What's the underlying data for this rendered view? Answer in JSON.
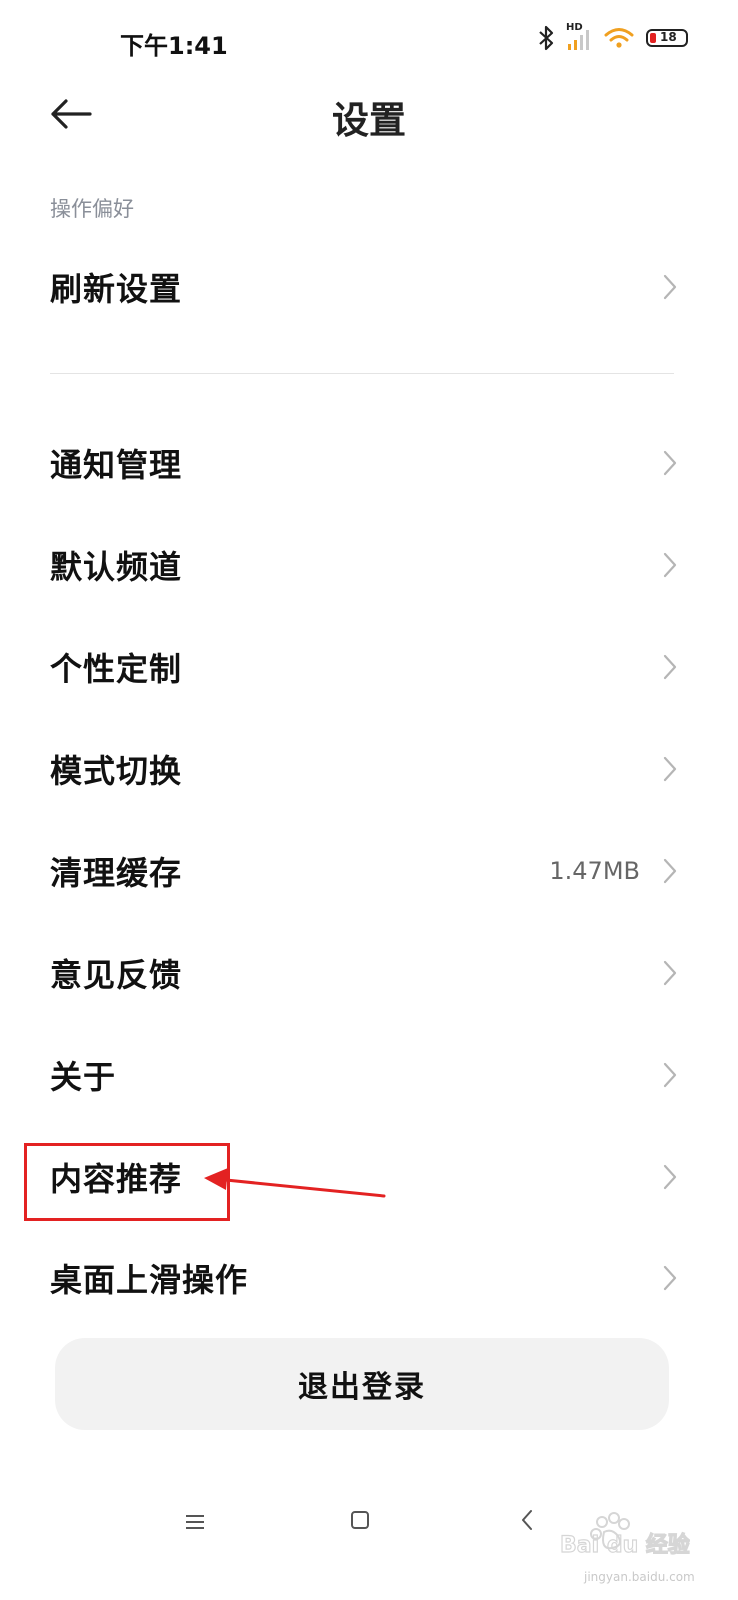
{
  "status_bar": {
    "time": "下午1:41",
    "network_label": "HD",
    "battery_level": "18"
  },
  "header": {
    "title": "设置",
    "back_icon": "arrow-left-icon"
  },
  "section": {
    "label": "操作偏好"
  },
  "rows": [
    {
      "label": "刷新设置",
      "value": ""
    },
    {
      "label": "通知管理",
      "value": ""
    },
    {
      "label": "默认频道",
      "value": ""
    },
    {
      "label": "个性定制",
      "value": ""
    },
    {
      "label": "模式切换",
      "value": ""
    },
    {
      "label": "清理缓存",
      "value": "1.47MB"
    },
    {
      "label": "意见反馈",
      "value": ""
    },
    {
      "label": "关于",
      "value": ""
    },
    {
      "label": "内容推荐",
      "value": ""
    },
    {
      "label": "桌面上滑操作",
      "value": ""
    }
  ],
  "logout": {
    "label": "退出登录"
  },
  "annotation": {
    "color": "#e32222"
  },
  "watermark": {
    "text": "jingyan.baidu.com"
  }
}
